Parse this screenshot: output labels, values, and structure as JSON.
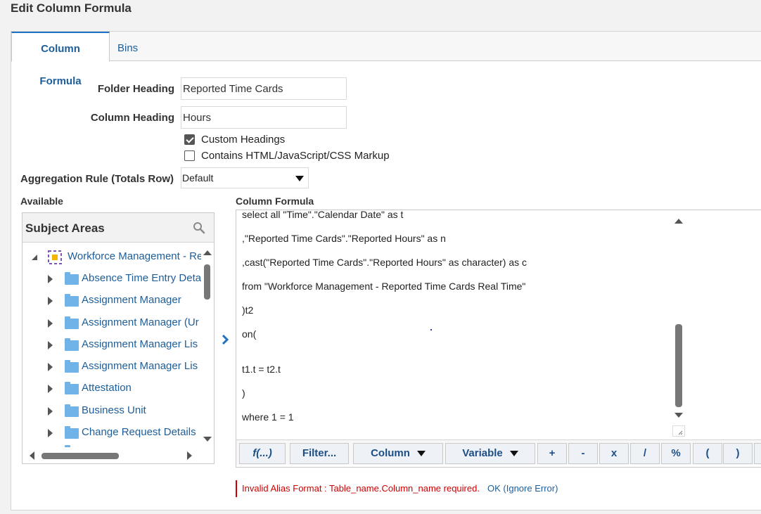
{
  "dialog": {
    "title": "Edit Column Formula"
  },
  "tabs": [
    {
      "label": "Column Formula",
      "active": true
    },
    {
      "label": "Bins",
      "active": false
    }
  ],
  "form": {
    "folder_heading_label": "Folder Heading",
    "folder_heading_value": "Reported Time Cards",
    "column_heading_label": "Column Heading",
    "column_heading_value": "Hours",
    "custom_headings_label": "Custom Headings",
    "custom_headings_checked": true,
    "contains_markup_label": "Contains HTML/JavaScript/CSS Markup",
    "contains_markup_checked": false,
    "aggregation_label": "Aggregation Rule (Totals Row)",
    "aggregation_value": "Default"
  },
  "available": {
    "label": "Available",
    "panel_title": "Subject Areas",
    "root_item": "Workforce Management - Re",
    "items": [
      "Absence Time Entry Deta",
      "Assignment Manager",
      "Assignment Manager (Ur",
      "Assignment Manager Lis",
      "Assignment Manager Lis",
      "Attestation",
      "Business Unit",
      "Change Request Details"
    ]
  },
  "formula": {
    "label": "Column Formula",
    "lines": [
      "select all \"Time\".\"Calendar Date\" as t",
      ",\"Reported Time Cards\".\"Reported Hours\" as n",
      ",cast(\"Reported Time Cards\".\"Reported Hours\" as character) as c",
      "from \"Workforce Management - Reported Time Cards Real Time\"",
      ")t2",
      "on(",
      "t1.t = t2.t",
      ")",
      "where 1 = 1"
    ]
  },
  "toolbar": {
    "fx": "f(...)",
    "filter": "Filter...",
    "column": "Column",
    "variable": "Variable",
    "plus": "+",
    "minus": "-",
    "times": "x",
    "divide": "/",
    "percent": "%",
    "open_paren": "(",
    "close_paren": ")"
  },
  "error": {
    "message": "Invalid Alias Format : Table_name.Column_name required.",
    "link": "OK (Ignore Error)"
  },
  "colors": {
    "link_blue": "#1d5e9a",
    "error_red": "#cc0000",
    "folder_blue": "#6fb3e8",
    "tab_accent": "#1d72c3"
  }
}
